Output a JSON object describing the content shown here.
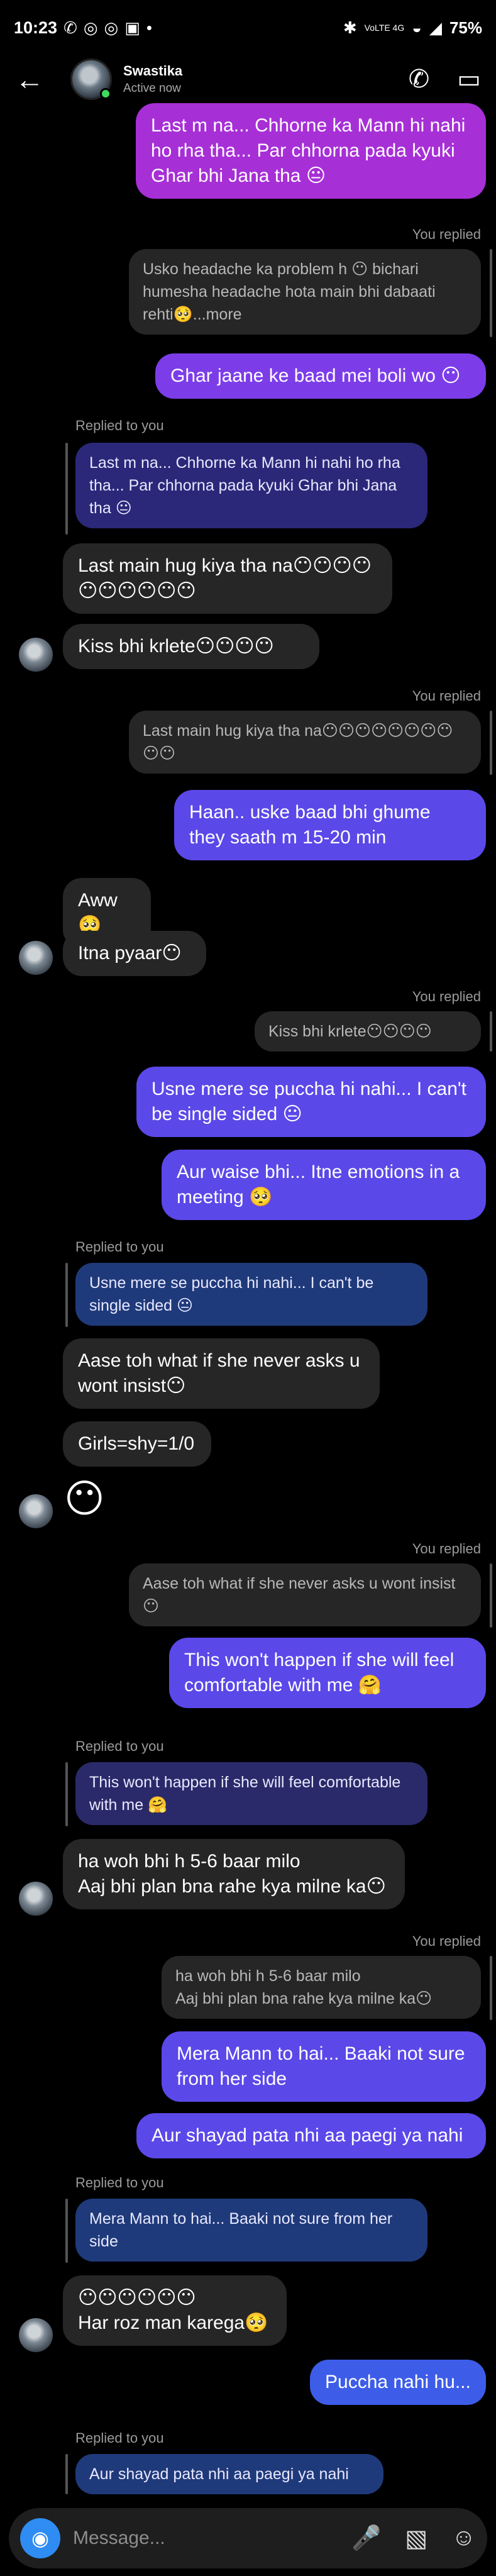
{
  "status_bar": {
    "time": "10:23",
    "icons": [
      "whatsapp-icon",
      "instagram-icon",
      "instagram-icon",
      "facebook-icon",
      "dot-icon"
    ],
    "network": "VoLTE 4G",
    "battery": "75%"
  },
  "header": {
    "name": "Swastika",
    "status": "Active now"
  },
  "messages": {
    "m1": "Last m na... Chhorne ka Mann hi nahi ho rha tha... Par chhorna pada kyuki Ghar bhi Jana tha 😐",
    "r1_label": "You replied",
    "r1_quote": "Usko headache ka problem h 😶 bichari humesha headache hota main bhi dabaati rehti🥺...more",
    "m2": "Ghar jaane ke baad mei boli wo 😶",
    "r2_label": "Replied to you",
    "r2_quote": "Last m na... Chhorne ka Mann hi nahi ho rha tha... Par chhorna pada kyuki Ghar bhi Jana tha 😐",
    "m3": "Last main hug kiya tha na😶😶😶😶😶😶😶😶😶😶",
    "m4": "Kiss bhi krlete😶😶😶😶",
    "r3_label": "You replied",
    "r3_quote": "Last main hug kiya tha na😶😶😶😶😶😶😶😶😶😶",
    "m5": "Haan.. uske baad bhi ghume they saath m 15-20 min",
    "m6": "Aww🥺",
    "m7": "Itna pyaar😶",
    "r4_label": "You replied",
    "r4_quote": "Kiss bhi krlete😶😶😶😶",
    "m8": "Usne mere se puccha hi nahi... I can't be single sided 😐",
    "m9": "Aur waise bhi... Itne emotions in a meeting 🥺",
    "r5_label": "Replied to you",
    "r5_quote": "Usne mere se puccha hi nahi... I can't be single sided 😐",
    "m10": "Aase toh what if she never asks u wont insist😶",
    "m11": "Girls=shy=1/0",
    "m12": "😶",
    "r6_label": "You replied",
    "r6_quote": "Aase toh what if she never asks u wont insist😶",
    "m13": "This won't happen if she will feel comfortable with me 🤗",
    "r7_label": "Replied to you",
    "r7_quote": "This won't happen if she will feel comfortable with me 🤗",
    "m14": "ha woh bhi h 5-6 baar milo\nAaj bhi plan bna rahe kya milne ka😶",
    "r8_label": "You replied",
    "r8_quote": "ha woh bhi h 5-6 baar milo\nAaj bhi plan bna rahe kya milne ka😶",
    "m15": "Mera Mann to hai... Baaki not sure from her side",
    "m16": "Aur shayad pata nhi aa paegi ya nahi",
    "r9_label": "Replied to you",
    "r9_quote": "Mera Mann to hai... Baaki not sure from her side",
    "m17": "😶😶😶😶😶😶\nHar roz man karega🥺",
    "m18": "Puccha nahi hu...",
    "r10_label": "Replied to you",
    "r10_quote": "Aur shayad pata nhi aa paegi ya nahi"
  },
  "composer": {
    "placeholder": "Message..."
  },
  "colors": {
    "outgoing_purple": "#a72fd6",
    "outgoing_indigo": "#5b48e8",
    "outgoing_blue": "#3d5de8",
    "incoming": "#262626",
    "camera": "#2f8cf2"
  }
}
